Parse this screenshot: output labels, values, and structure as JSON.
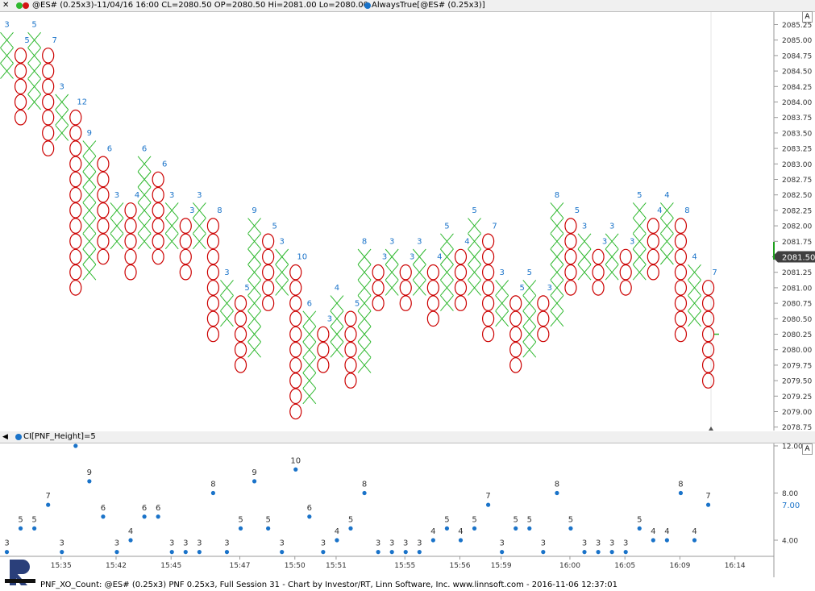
{
  "header1": {
    "close": "✕",
    "symbol_text": "@ES# (0.25x3)-11/04/16 16:00 CL=2080.50 OP=2080.50 Hi=2081.00 Lo=2080.00",
    "indicator_text": "AlwaysTrue[@ES# (0.25x3)]"
  },
  "header2": {
    "indicator_text": "CI[PNF_Height]=5"
  },
  "scale_button": "A",
  "footer_text": "PNF_XO_Count: @ES# (0.25x3) PNF 0.25x3, Full Session 31 - Chart by Investor/RT, Linn Software, Inc. www.linnsoft.com - 2016-11-06 12:37:01",
  "colors": {
    "x_mark": "#2eb82e",
    "o_mark": "#cc0000",
    "count_label": "#1a73c9",
    "dot": "#1a73c9",
    "price_tag": "#3f3f3f",
    "value_tag": "#1a73c9"
  },
  "chart_data": [
    {
      "type": "point-and-figure",
      "box_size": 0.25,
      "reversal": 3,
      "y_axis_ticks": [
        "2085.25",
        "2085.00",
        "2084.75",
        "2084.50",
        "2084.25",
        "2084.00",
        "2083.75",
        "2083.50",
        "2083.25",
        "2083.00",
        "2082.75",
        "2082.50",
        "2082.25",
        "2082.00",
        "2081.75",
        "2081.50",
        "2081.25",
        "2081.00",
        "2080.75",
        "2080.50",
        "2080.25",
        "2080.00",
        "2079.75",
        "2079.50",
        "2079.25",
        "2079.00",
        "2078.75"
      ],
      "ylim": [
        2078.75,
        2085.25
      ],
      "last_price": "2081.50",
      "columns": [
        {
          "type": "X",
          "low": 2084.5,
          "high": 2085.0,
          "count": 3
        },
        {
          "type": "O",
          "low": 2083.75,
          "high": 2084.75,
          "count": 5
        },
        {
          "type": "X",
          "low": 2084.0,
          "high": 2085.0,
          "count": 5
        },
        {
          "type": "O",
          "low": 2083.25,
          "high": 2084.75,
          "count": 7
        },
        {
          "type": "X",
          "low": 2083.5,
          "high": 2084.0,
          "count": 3
        },
        {
          "type": "O",
          "low": 2081.0,
          "high": 2083.75,
          "count": 12
        },
        {
          "type": "X",
          "low": 2081.25,
          "high": 2083.25,
          "count": 9
        },
        {
          "type": "O",
          "low": 2081.5,
          "high": 2083.0,
          "count": 6
        },
        {
          "type": "X",
          "low": 2081.75,
          "high": 2082.25,
          "count": 3
        },
        {
          "type": "O",
          "low": 2081.25,
          "high": 2082.25,
          "count": 4
        },
        {
          "type": "X",
          "low": 2081.75,
          "high": 2083.0,
          "count": 6
        },
        {
          "type": "O",
          "low": 2081.5,
          "high": 2082.75,
          "count": 6
        },
        {
          "type": "X",
          "low": 2081.75,
          "high": 2082.25,
          "count": 3
        },
        {
          "type": "O",
          "low": 2081.25,
          "high": 2082.0,
          "count": 3
        },
        {
          "type": "X",
          "low": 2081.75,
          "high": 2082.25,
          "count": 3
        },
        {
          "type": "O",
          "low": 2080.25,
          "high": 2082.0,
          "count": 8
        },
        {
          "type": "X",
          "low": 2080.5,
          "high": 2081.0,
          "count": 3
        },
        {
          "type": "O",
          "low": 2079.75,
          "high": 2080.75,
          "count": 5
        },
        {
          "type": "X",
          "low": 2080.0,
          "high": 2082.0,
          "count": 9
        },
        {
          "type": "O",
          "low": 2080.75,
          "high": 2081.75,
          "count": 5
        },
        {
          "type": "X",
          "low": 2081.0,
          "high": 2081.5,
          "count": 3
        },
        {
          "type": "O",
          "low": 2079.0,
          "high": 2081.25,
          "count": 10
        },
        {
          "type": "X",
          "low": 2079.25,
          "high": 2080.5,
          "count": 6
        },
        {
          "type": "O",
          "low": 2079.75,
          "high": 2080.25,
          "count": 3
        },
        {
          "type": "X",
          "low": 2080.0,
          "high": 2080.75,
          "count": 4
        },
        {
          "type": "O",
          "low": 2079.5,
          "high": 2080.5,
          "count": 5
        },
        {
          "type": "X",
          "low": 2079.75,
          "high": 2081.5,
          "count": 8
        },
        {
          "type": "O",
          "low": 2080.75,
          "high": 2081.25,
          "count": 3
        },
        {
          "type": "X",
          "low": 2081.0,
          "high": 2081.5,
          "count": 3
        },
        {
          "type": "O",
          "low": 2080.75,
          "high": 2081.25,
          "count": 3
        },
        {
          "type": "X",
          "low": 2081.0,
          "high": 2081.5,
          "count": 3
        },
        {
          "type": "O",
          "low": 2080.5,
          "high": 2081.25,
          "count": 4
        },
        {
          "type": "X",
          "low": 2080.75,
          "high": 2081.75,
          "count": 5
        },
        {
          "type": "O",
          "low": 2080.75,
          "high": 2081.5,
          "count": 4
        },
        {
          "type": "X",
          "low": 2081.0,
          "high": 2082.0,
          "count": 5
        },
        {
          "type": "O",
          "low": 2080.25,
          "high": 2081.75,
          "count": 7
        },
        {
          "type": "X",
          "low": 2080.5,
          "high": 2081.0,
          "count": 3
        },
        {
          "type": "O",
          "low": 2079.75,
          "high": 2080.75,
          "count": 5
        },
        {
          "type": "X",
          "low": 2080.0,
          "high": 2081.0,
          "count": 5
        },
        {
          "type": "O",
          "low": 2080.25,
          "high": 2080.75,
          "count": 3
        },
        {
          "type": "X",
          "low": 2080.5,
          "high": 2082.25,
          "count": 8
        },
        {
          "type": "O",
          "low": 2081.0,
          "high": 2082.0,
          "count": 5
        },
        {
          "type": "X",
          "low": 2081.25,
          "high": 2081.75,
          "count": 3
        },
        {
          "type": "O",
          "low": 2081.0,
          "high": 2081.5,
          "count": 3
        },
        {
          "type": "X",
          "low": 2081.25,
          "high": 2081.75,
          "count": 3
        },
        {
          "type": "O",
          "low": 2081.0,
          "high": 2081.5,
          "count": 3
        },
        {
          "type": "X",
          "low": 2081.25,
          "high": 2082.25,
          "count": 5
        },
        {
          "type": "O",
          "low": 2081.25,
          "high": 2082.0,
          "count": 4
        },
        {
          "type": "X",
          "low": 2081.5,
          "high": 2082.25,
          "count": 4
        },
        {
          "type": "O",
          "low": 2080.25,
          "high": 2082.0,
          "count": 8
        },
        {
          "type": "X",
          "low": 2080.5,
          "high": 2081.25,
          "count": 4
        },
        {
          "type": "O",
          "low": 2079.5,
          "high": 2081.0,
          "count": 7
        }
      ]
    },
    {
      "type": "scatter",
      "series": [
        {
          "name": "CI[PNF_Height]",
          "values": [
            3,
            5,
            5,
            7,
            3,
            12,
            9,
            6,
            3,
            4,
            6,
            6,
            3,
            3,
            3,
            8,
            3,
            5,
            9,
            5,
            3,
            10,
            6,
            3,
            4,
            5,
            8,
            3,
            3,
            3,
            3,
            4,
            5,
            4,
            5,
            7,
            3,
            5,
            5,
            3,
            8,
            5,
            3,
            3,
            3,
            3,
            5,
            4,
            4,
            8,
            4,
            7
          ]
        }
      ],
      "y_axis_ticks": [
        "12.00",
        "8.00",
        "4.00"
      ],
      "ylim": [
        2.5,
        12.5
      ],
      "current_value": "7.00",
      "x_tick_labels": [
        "15:35",
        "15:42",
        "15:45",
        "15:47",
        "15:50",
        "15:51",
        "15:55",
        "15:56",
        "15:59",
        "16:00",
        "16:05",
        "16:09",
        "16:14"
      ],
      "x_tick_columns": [
        4,
        8,
        12,
        17,
        21,
        24,
        29,
        33,
        36,
        41,
        45,
        49,
        53
      ]
    }
  ]
}
